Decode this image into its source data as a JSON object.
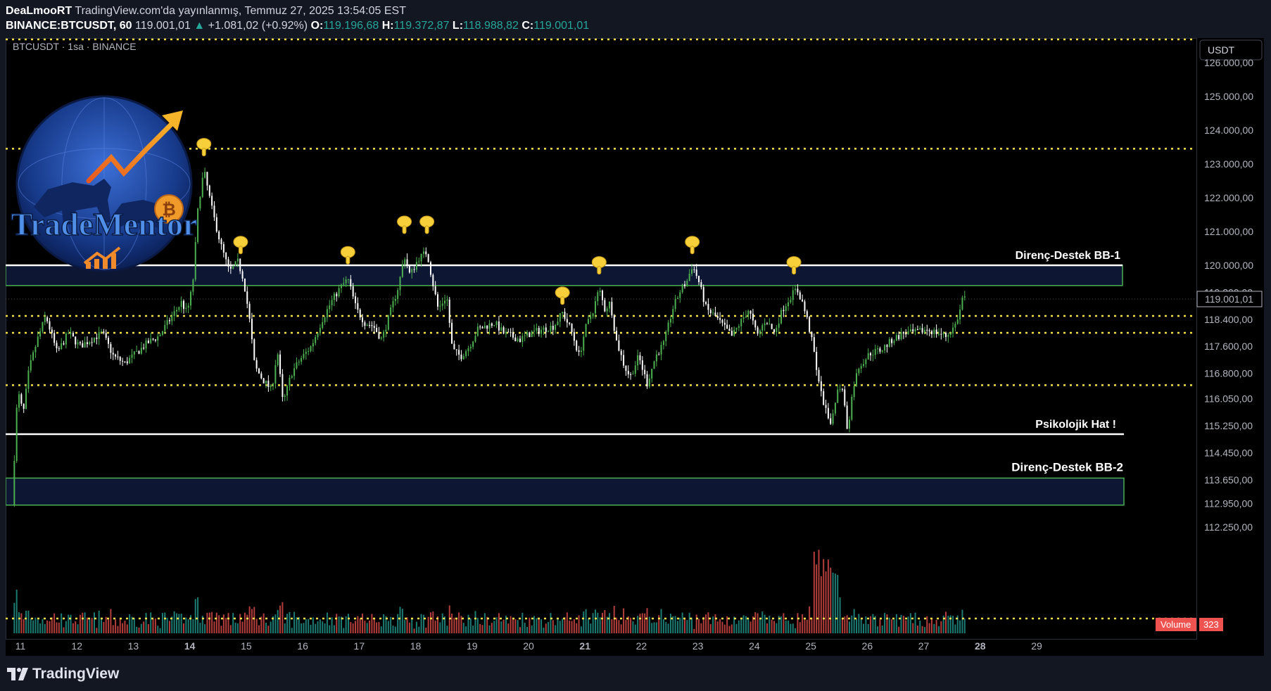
{
  "header": {
    "author": "DeaLmooRT",
    "published": "TradingView.com'da yayınlanmış, Temmuz 27, 2025 13:54:05 EST",
    "symbol": "BINANCE:BTCUSDT, 60",
    "last": "119.001,01",
    "change_arrow": "▲",
    "change": "+1.081,02 (+0.92%)",
    "o_label": "O:",
    "o_value": "119.196,68",
    "h_label": "H:",
    "h_value": "119.372,87",
    "l_label": "L:",
    "l_value": "118.988,82",
    "c_label": "C:",
    "c_value": "119.001,01"
  },
  "chart_legend": "BTCUSDT · 1sa · BINANCE",
  "currency": "USDT",
  "logo_text": "TradeMentor",
  "volume_badge": {
    "label": "Volume",
    "value": "323"
  },
  "footer": {
    "brand": "TradingView"
  },
  "colors": {
    "background": "#000000",
    "up": "#4caf50",
    "down": "#ffffff",
    "dotted_level": "#f7e14b",
    "zone_border": "#4caf50",
    "zone_fill": "#0d1633",
    "solid_line": "#ffffff",
    "volume_up": "#26a69a",
    "volume_down": "#ef5350"
  },
  "chart_data": {
    "type": "candlestick",
    "ylim": [
      111500,
      126500
    ],
    "y_ticks": [
      126000,
      125000,
      124000,
      123000,
      122000,
      121000,
      120000,
      119200,
      118400,
      117600,
      116800,
      116050,
      115250,
      114450,
      113650,
      112950,
      112250
    ],
    "y_tick_labels": [
      "126.000,00",
      "125.000,00",
      "124.000,00",
      "123.000,00",
      "122.000,00",
      "121.000,00",
      "120.000,00",
      "119.200,00",
      "118.400,00",
      "117.600,00",
      "116.800,00",
      "116.050,00",
      "115.250,00",
      "114.450,00",
      "113.650,00",
      "112.950,00",
      "112.250,00"
    ],
    "x_labels": [
      {
        "label": "11",
        "day": 11
      },
      {
        "label": "12",
        "day": 12
      },
      {
        "label": "13",
        "day": 13
      },
      {
        "label": "14",
        "day": 14
      },
      {
        "label": "15",
        "day": 15
      },
      {
        "label": "16",
        "day": 16
      },
      {
        "label": "17",
        "day": 17
      },
      {
        "label": "18",
        "day": 18
      },
      {
        "label": "19",
        "day": 19
      },
      {
        "label": "20",
        "day": 20
      },
      {
        "label": "21",
        "day": 21
      },
      {
        "label": "22",
        "day": 22
      },
      {
        "label": "23",
        "day": 23
      },
      {
        "label": "24",
        "day": 24
      },
      {
        "label": "25",
        "day": 25
      },
      {
        "label": "26",
        "day": 26
      },
      {
        "label": "27",
        "day": 27
      },
      {
        "label": "28",
        "day": 28
      },
      {
        "label": "29",
        "day": 29
      }
    ],
    "x_range_days": [
      11,
      29
    ],
    "bold_day_labels": [
      14,
      21,
      28
    ],
    "last_price": 119001.01,
    "last_price_label": "119.001,01",
    "dotted_levels": [
      126600,
      123450,
      118500,
      118000,
      116450,
      112100
    ],
    "zones": [
      {
        "top": 120000,
        "bottom": 119400,
        "label": "Direnç-Destek BB-1"
      },
      {
        "top": 113700,
        "bottom": 112900,
        "label": "Direnç-Destek BB-2"
      }
    ],
    "solid_lines": [
      {
        "value": 120000
      },
      {
        "value": 115000,
        "label": "Psikolojik Hat !"
      }
    ],
    "markers": [
      {
        "day": 14.4,
        "price": 123300
      },
      {
        "day": 15.05,
        "price": 120400
      },
      {
        "day": 16.95,
        "price": 120100
      },
      {
        "day": 17.95,
        "price": 121000
      },
      {
        "day": 18.35,
        "price": 121000
      },
      {
        "day": 20.75,
        "price": 118900
      },
      {
        "day": 21.4,
        "price": 119800
      },
      {
        "day": 23.05,
        "price": 120400
      },
      {
        "day": 24.85,
        "price": 119800
      }
    ],
    "path": [
      [
        11.0,
        112900
      ],
      [
        11.1,
        116300
      ],
      [
        11.2,
        115600
      ],
      [
        11.3,
        116900
      ],
      [
        11.45,
        117800
      ],
      [
        11.6,
        118500
      ],
      [
        11.8,
        117400
      ],
      [
        12.0,
        118000
      ],
      [
        12.2,
        117600
      ],
      [
        12.4,
        117800
      ],
      [
        12.6,
        118000
      ],
      [
        12.8,
        117300
      ],
      [
        13.0,
        117100
      ],
      [
        13.2,
        117400
      ],
      [
        13.4,
        117700
      ],
      [
        13.6,
        117900
      ],
      [
        13.8,
        118400
      ],
      [
        14.0,
        118900
      ],
      [
        14.1,
        118600
      ],
      [
        14.2,
        119400
      ],
      [
        14.3,
        121800
      ],
      [
        14.4,
        122800
      ],
      [
        14.55,
        121600
      ],
      [
        14.7,
        120600
      ],
      [
        14.85,
        119800
      ],
      [
        15.0,
        120100
      ],
      [
        15.1,
        119600
      ],
      [
        15.2,
        118500
      ],
      [
        15.3,
        117000
      ],
      [
        15.45,
        116600
      ],
      [
        15.6,
        116300
      ],
      [
        15.7,
        117500
      ],
      [
        15.8,
        115900
      ],
      [
        15.95,
        116800
      ],
      [
        16.1,
        117200
      ],
      [
        16.3,
        117600
      ],
      [
        16.5,
        118400
      ],
      [
        16.65,
        118900
      ],
      [
        16.8,
        119300
      ],
      [
        16.95,
        119600
      ],
      [
        17.1,
        118700
      ],
      [
        17.25,
        118300
      ],
      [
        17.4,
        118200
      ],
      [
        17.55,
        117800
      ],
      [
        17.7,
        118600
      ],
      [
        17.85,
        119400
      ],
      [
        17.95,
        120300
      ],
      [
        18.05,
        119700
      ],
      [
        18.2,
        120200
      ],
      [
        18.35,
        120400
      ],
      [
        18.45,
        119500
      ],
      [
        18.55,
        118700
      ],
      [
        18.7,
        119100
      ],
      [
        18.8,
        117500
      ],
      [
        18.95,
        117300
      ],
      [
        19.1,
        117600
      ],
      [
        19.25,
        118100
      ],
      [
        19.4,
        118200
      ],
      [
        19.55,
        118300
      ],
      [
        19.7,
        118000
      ],
      [
        19.85,
        117900
      ],
      [
        20.0,
        117800
      ],
      [
        20.2,
        118000
      ],
      [
        20.4,
        118100
      ],
      [
        20.6,
        118200
      ],
      [
        20.75,
        118600
      ],
      [
        20.9,
        118100
      ],
      [
        21.05,
        117300
      ],
      [
        21.15,
        118100
      ],
      [
        21.3,
        118700
      ],
      [
        21.4,
        119300
      ],
      [
        21.5,
        118700
      ],
      [
        21.6,
        118900
      ],
      [
        21.7,
        117800
      ],
      [
        21.85,
        117000
      ],
      [
        21.95,
        116700
      ],
      [
        22.1,
        117300
      ],
      [
        22.25,
        116500
      ],
      [
        22.4,
        117300
      ],
      [
        22.55,
        117700
      ],
      [
        22.7,
        118700
      ],
      [
        22.85,
        119300
      ],
      [
        22.95,
        119500
      ],
      [
        23.05,
        120000
      ],
      [
        23.15,
        119600
      ],
      [
        23.3,
        118700
      ],
      [
        23.45,
        118500
      ],
      [
        23.6,
        118200
      ],
      [
        23.75,
        117900
      ],
      [
        23.9,
        118300
      ],
      [
        24.05,
        118700
      ],
      [
        24.2,
        117900
      ],
      [
        24.35,
        118400
      ],
      [
        24.5,
        118000
      ],
      [
        24.65,
        118700
      ],
      [
        24.8,
        119100
      ],
      [
        24.9,
        119300
      ],
      [
        25.0,
        118900
      ],
      [
        25.1,
        118300
      ],
      [
        25.2,
        117500
      ],
      [
        25.3,
        116400
      ],
      [
        25.4,
        115800
      ],
      [
        25.5,
        115200
      ],
      [
        25.6,
        116200
      ],
      [
        25.7,
        116500
      ],
      [
        25.8,
        115100
      ],
      [
        25.9,
        116400
      ],
      [
        26.0,
        117000
      ],
      [
        26.2,
        117400
      ],
      [
        26.4,
        117500
      ],
      [
        26.6,
        117800
      ],
      [
        26.8,
        118000
      ],
      [
        27.0,
        118000
      ],
      [
        27.2,
        118100
      ],
      [
        27.4,
        118000
      ],
      [
        27.55,
        117900
      ],
      [
        27.7,
        118200
      ],
      [
        27.8,
        118700
      ],
      [
        27.85,
        119200
      ],
      [
        27.88,
        119000
      ]
    ]
  }
}
